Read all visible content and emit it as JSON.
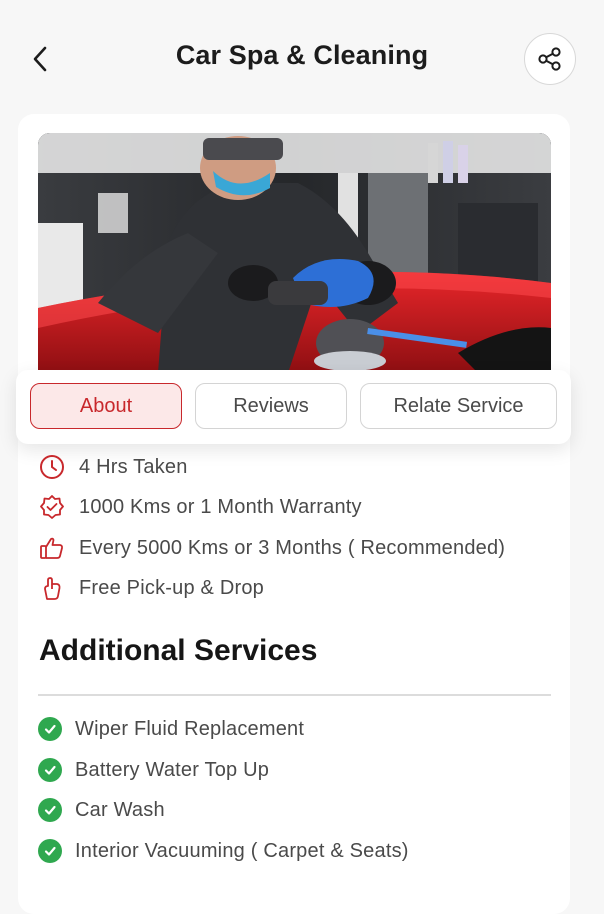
{
  "header": {
    "title": "Car Spa & Cleaning",
    "back_icon": "chevron-left-icon",
    "share_icon": "share-icon"
  },
  "hero": {
    "image_subject": "technician polishing red car with rotary buffer"
  },
  "tabs": [
    {
      "label": "About",
      "active": true
    },
    {
      "label": "Reviews",
      "active": false
    },
    {
      "label": "Relate Service",
      "active": false
    }
  ],
  "details": [
    {
      "icon": "clock-icon",
      "text": "4 Hrs Taken"
    },
    {
      "icon": "warranty-badge-icon",
      "text": "1000 Kms or 1 Month Warranty"
    },
    {
      "icon": "thumbs-up-icon",
      "text": "Every 5000 Kms or 3 Months ( Recommended)"
    },
    {
      "icon": "hand-pickup-icon",
      "text": "Free Pick-up & Drop"
    }
  ],
  "additional": {
    "title": "Additional Services",
    "items": [
      "Wiper Fluid Replacement",
      "Battery Water Top Up",
      "Car Wash",
      "Interior Vacuuming ( Carpet & Seats)"
    ]
  },
  "colors": {
    "accent": "#c8282c",
    "accent_bg": "#fce8e8",
    "check_green": "#2fa84f",
    "text": "#4a4a4a",
    "background": "#f7f7f7"
  }
}
